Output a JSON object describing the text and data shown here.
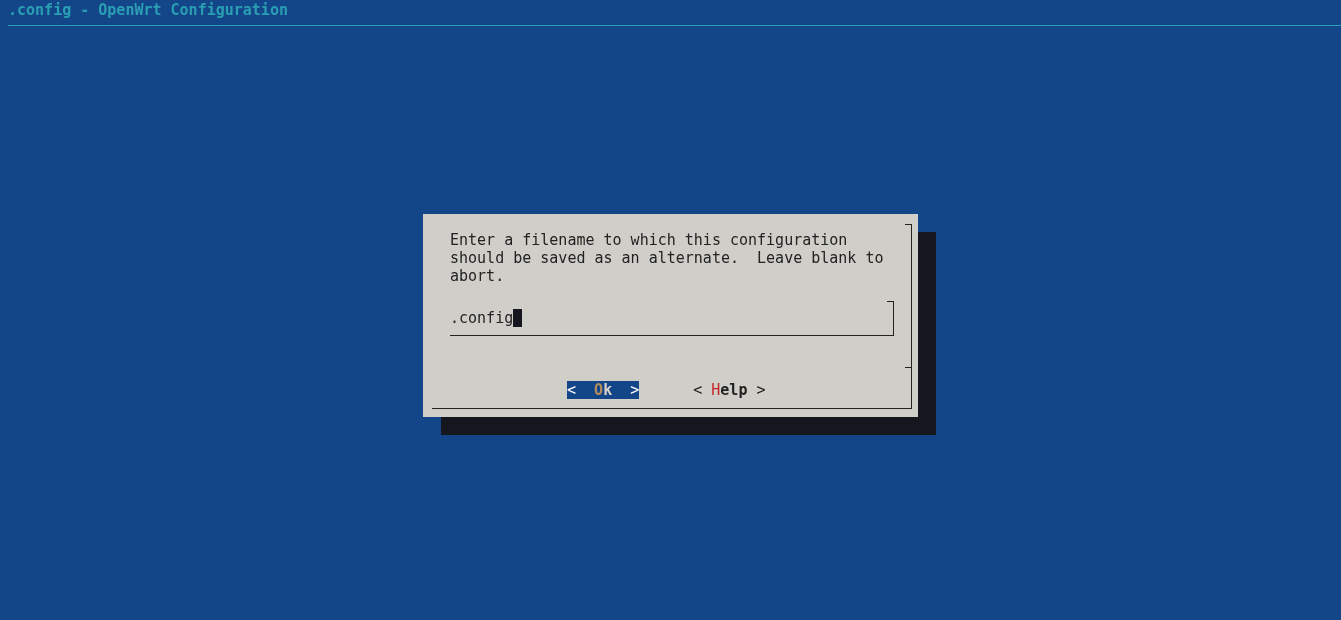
{
  "window": {
    "title": ".config - OpenWrt Configuration"
  },
  "dialog": {
    "message": "Enter a filename to which this configuration\nshould be saved as an alternate.  Leave blank to\nabort.",
    "field": {
      "value": ".config",
      "cursor": true
    },
    "buttons": [
      {
        "open": "<",
        "hotkey": "O",
        "rest": "k",
        "close": ">",
        "selected": true
      },
      {
        "open": "<",
        "hotkey": "H",
        "rest": "elp",
        "close": ">",
        "selected": false
      }
    ]
  }
}
